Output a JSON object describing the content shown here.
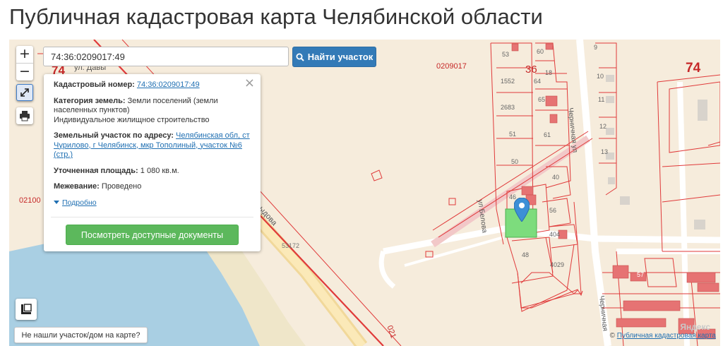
{
  "page": {
    "title": "Публичная кадастровая карта Челябинской области"
  },
  "controls": {
    "zoom_in": "+",
    "zoom_out": "−",
    "search_value": "74:36:0209017:49",
    "find_button": "Найти участок",
    "not_found_link": "Не нашли участок/дом на карте?"
  },
  "popup": {
    "cad_label": "Кадастровый номер:",
    "cad_value": "74:36:0209017:49",
    "category_label": "Категория земель:",
    "category_value": "Земли поселений (земли населенных пунктов)",
    "use_value": "Индивидуальное жилищное строительство",
    "address_label": "Земельный участок по адресу:",
    "address_value": "Челябинская обл, ст Чурилово, г Челябинск, мкр Тополиный, участок №6 (стр.)",
    "area_label": "Уточненная площадь:",
    "area_value": "1 080 кв.м.",
    "survey_label": "Межевание:",
    "survey_value": "Проведено",
    "details_link": "Подробно",
    "docs_button": "Посмотреть доступные документы",
    "close": "×"
  },
  "map_labels": {
    "block_74_left": "74",
    "street_davy": "ул. Давы",
    "block_74_right": "74",
    "block_36": "36",
    "quarter_0209017": "0209017",
    "quarter_0210_left": "02100",
    "quarter_021_bottom": "021",
    "street_ydova": "ыдова",
    "num_53172": "53172",
    "street_belova": "ул Белова",
    "street_cherni_top": "Черничная ул",
    "street_cherni_bottom": "Черничная",
    "plots": {
      "p53": "53",
      "p60": "60",
      "p1552": "1552",
      "p64": "64",
      "p18": "18",
      "p2683": "2683",
      "p65": "65",
      "p51": "51",
      "p61": "61",
      "p50": "50",
      "p40": "40",
      "p46": "46",
      "p56": "56",
      "p404": "404",
      "p48": "48",
      "p4029": "4029",
      "p9": "9",
      "p10": "10",
      "p11": "11",
      "p12": "12",
      "p13": "13",
      "p57": "57"
    }
  },
  "attribution": {
    "prefix": "©",
    "link": "Публичная кадастровая карта",
    "watermark": "Яндекс"
  },
  "colors": {
    "boundary": "#e03a3a",
    "selected_fill": "#7ddc7d",
    "water": "#a9cfe3",
    "road": "#ffffff",
    "marker": "#3d8fd6",
    "building": "#e05555"
  }
}
